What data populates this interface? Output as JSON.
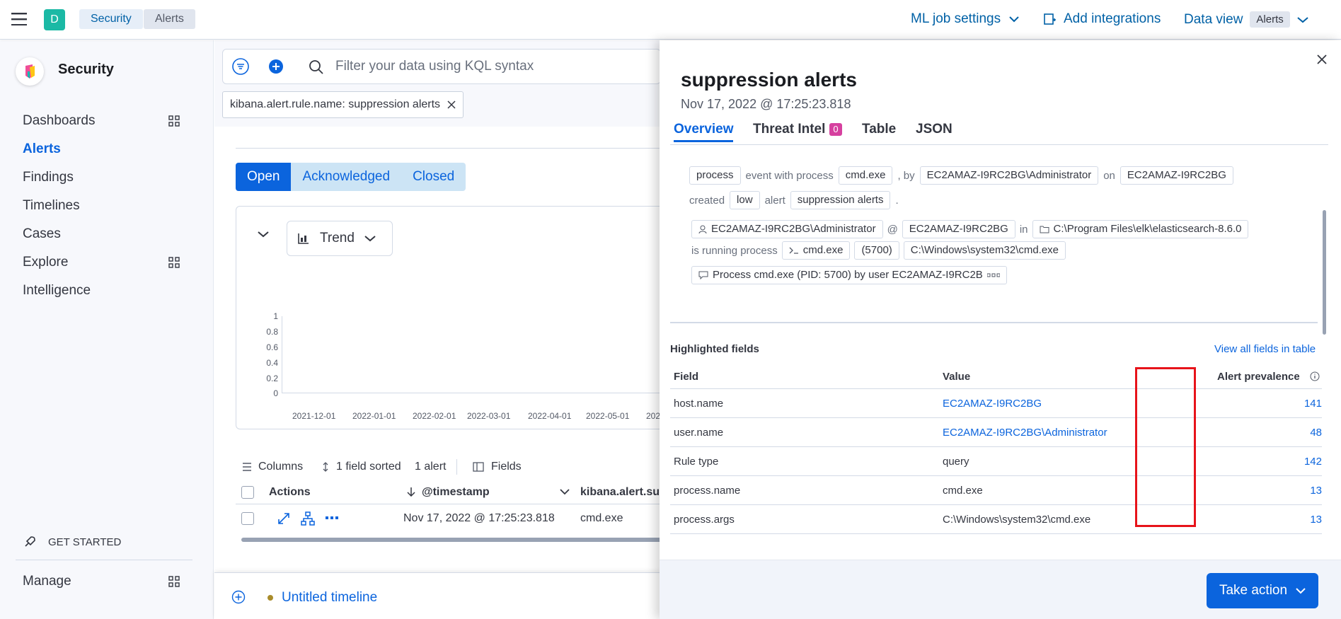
{
  "header": {
    "space_avatar": "D",
    "breadcrumbs": [
      "Security",
      "Alerts"
    ],
    "ml_job_settings": "ML job settings",
    "add_integrations": "Add integrations",
    "data_view_label": "Data view",
    "data_view_value": "Alerts"
  },
  "sidebar": {
    "title": "Security",
    "items": [
      {
        "label": "Dashboards"
      },
      {
        "label": "Alerts"
      },
      {
        "label": "Findings"
      },
      {
        "label": "Timelines"
      },
      {
        "label": "Cases"
      },
      {
        "label": "Explore"
      },
      {
        "label": "Intelligence"
      }
    ],
    "get_started": "GET STARTED",
    "manage": "Manage"
  },
  "main": {
    "search_placeholder": "Filter your data using KQL syntax",
    "filter_pill": "kibana.alert.rule.name: suppression alerts",
    "status_tabs": [
      "Open",
      "Acknowledged",
      "Closed"
    ],
    "trend_label": "Trend",
    "y_ticks": [
      "1",
      "0.8",
      "0.6",
      "0.4",
      "0.2",
      "0"
    ],
    "x_ticks": [
      "2021-12-01",
      "2022-01-01",
      "2022-02-01",
      "2022-03-01",
      "2022-04-01",
      "2022-05-01",
      "202"
    ],
    "toolbar": {
      "columns": "Columns",
      "sorted": "1 field sorted",
      "alert_count": "1 alert",
      "fields": "Fields"
    },
    "table": {
      "headers": [
        "Actions",
        "@timestamp",
        "kibana.alert.su"
      ],
      "row": {
        "timestamp": "Nov 17, 2022 @ 17:25:23.818",
        "process": "cmd.exe"
      }
    },
    "timeline": "Untitled timeline"
  },
  "flyout": {
    "title": "suppression alerts",
    "timestamp": "Nov 17, 2022 @ 17:25:23.818",
    "tabs": [
      "Overview",
      "Threat Intel",
      "Table",
      "JSON"
    ],
    "threat_intel_count": "0",
    "summary": {
      "process": "process",
      "event_with_process": "event with process",
      "process_name": "cmd.exe",
      "by": ", by",
      "user": "EC2AMAZ-I9RC2BG\\Administrator",
      "on": "on",
      "host": "EC2AMAZ-I9RC2BG",
      "created": "created",
      "severity": "low",
      "alert": "alert",
      "rule": "suppression alerts",
      "period": "."
    },
    "process_tree": {
      "user": "EC2AMAZ-I9RC2BG\\Administrator",
      "at": "@",
      "host": "EC2AMAZ-I9RC2BG",
      "in": "in",
      "dir": "C:\\Program Files\\elk\\elasticsearch-8.6.0",
      "is_running": "is running process",
      "process": "cmd.exe",
      "pid": "(5700)",
      "exe": "C:\\Windows\\system32\\cmd.exe",
      "message": "Process cmd.exe (PID: 5700) by user EC2AMAZ-I9RC2B"
    },
    "highlighted_title": "Highlighted fields",
    "view_all": "View all fields in table",
    "columns": [
      "Field",
      "Value",
      "Alert prevalence"
    ],
    "rows": [
      {
        "field": "host.name",
        "value": "EC2AMAZ-I9RC2BG",
        "count": "141",
        "link": true
      },
      {
        "field": "user.name",
        "value": "EC2AMAZ-I9RC2BG\\Administrator",
        "count": "48",
        "link": true
      },
      {
        "field": "Rule type",
        "value": "query",
        "count": "142",
        "link": false
      },
      {
        "field": "process.name",
        "value": "cmd.exe",
        "count": "13",
        "link": false
      },
      {
        "field": "process.args",
        "value": "C:\\Windows\\system32\\cmd.exe",
        "count": "13",
        "link": false
      }
    ],
    "take_action": "Take action"
  },
  "colors": {
    "accent": "#0b64dd",
    "highlight_box": "#e7131a",
    "badge": "#d6409f"
  }
}
